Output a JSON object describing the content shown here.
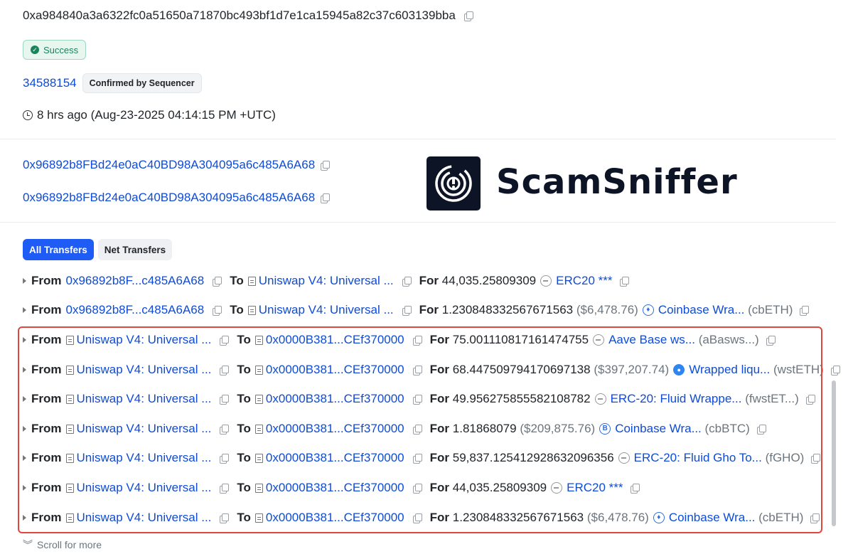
{
  "tx": {
    "hash": "0xa984840a3a6322fc0a51650a71870bc493bf1d7e1ca15945a82c37c603139bba",
    "status": "Success",
    "block": "34588154",
    "confirmation": "Confirmed by Sequencer",
    "timestamp": "8 hrs ago (Aug-23-2025 04:14:15 PM +UTC)",
    "from_address": "0x96892b8FBd24e0aC40BD98A304095a6c485A6A68",
    "to_address": "0x96892b8FBd24e0aC40BD98A304095a6c485A6A68"
  },
  "watermark": {
    "name": "ScamSniffer"
  },
  "tabs": [
    {
      "label": "All Transfers",
      "active": true
    },
    {
      "label": "Net Transfers",
      "active": false
    }
  ],
  "labels": {
    "from": "From",
    "to": "To",
    "for": "For"
  },
  "transfers": [
    {
      "from": "0x96892b8F...c485A6A68",
      "from_contract": false,
      "to": "Uniswap V4: Universal ...",
      "to_contract": true,
      "amount": "44,035.25809309",
      "usd": "",
      "token": "ERC20 ***",
      "symbol": "",
      "icon": "grey-token-icon"
    },
    {
      "from": "0x96892b8F...c485A6A68",
      "from_contract": false,
      "to": "Uniswap V4: Universal ...",
      "to_contract": true,
      "amount": "1.230848332567671563",
      "usd": "($6,478.76)",
      "token": "Coinbase Wra...",
      "symbol": "(cbETH)",
      "icon": "eth-token-icon"
    },
    {
      "from": "Uniswap V4: Universal ...",
      "from_contract": true,
      "to": "0x0000B381...CEf370000",
      "to_contract": true,
      "amount": "75.001110817161474755",
      "usd": "",
      "token": "Aave Base ws...",
      "symbol": "(aBasws...)",
      "icon": "grey-token-icon"
    },
    {
      "from": "Uniswap V4: Universal ...",
      "from_contract": true,
      "to": "0x0000B381...CEf370000",
      "to_contract": true,
      "amount": "68.447509794170697138",
      "usd": "($397,207.74)",
      "token": "Wrapped liqu...",
      "symbol": "(wstETH)",
      "icon": "drop-token-icon"
    },
    {
      "from": "Uniswap V4: Universal ...",
      "from_contract": true,
      "to": "0x0000B381...CEf370000",
      "to_contract": true,
      "amount": "49.956275855582108782",
      "usd": "",
      "token": "ERC-20: Fluid Wrappe...",
      "symbol": "(fwstET...)",
      "icon": "grey-token-icon"
    },
    {
      "from": "Uniswap V4: Universal ...",
      "from_contract": true,
      "to": "0x0000B381...CEf370000",
      "to_contract": true,
      "amount": "1.81868079",
      "usd": "($209,875.76)",
      "token": "Coinbase Wra...",
      "symbol": "(cbBTC)",
      "icon": "btc-token-icon"
    },
    {
      "from": "Uniswap V4: Universal ...",
      "from_contract": true,
      "to": "0x0000B381...CEf370000",
      "to_contract": true,
      "amount": "59,837.125412928632096356",
      "usd": "",
      "token": "ERC-20: Fluid Gho To...",
      "symbol": "(fGHO)",
      "icon": "grey-token-icon"
    },
    {
      "from": "Uniswap V4: Universal ...",
      "from_contract": true,
      "to": "0x0000B381...CEf370000",
      "to_contract": true,
      "amount": "44,035.25809309",
      "usd": "",
      "token": "ERC20 ***",
      "symbol": "",
      "icon": "grey-token-icon"
    },
    {
      "from": "Uniswap V4: Universal ...",
      "from_contract": true,
      "to": "0x0000B381...CEf370000",
      "to_contract": true,
      "amount": "1.230848332567671563",
      "usd": "($6,478.76)",
      "token": "Coinbase Wra...",
      "symbol": "(cbETH)",
      "icon": "eth-token-icon"
    }
  ],
  "footer": {
    "scroll_more": "Scroll for more"
  },
  "colors": {
    "link": "#0d4bd8",
    "highlight": "#e0463a",
    "success": "#188459",
    "tab_active": "#1f5bf5"
  }
}
